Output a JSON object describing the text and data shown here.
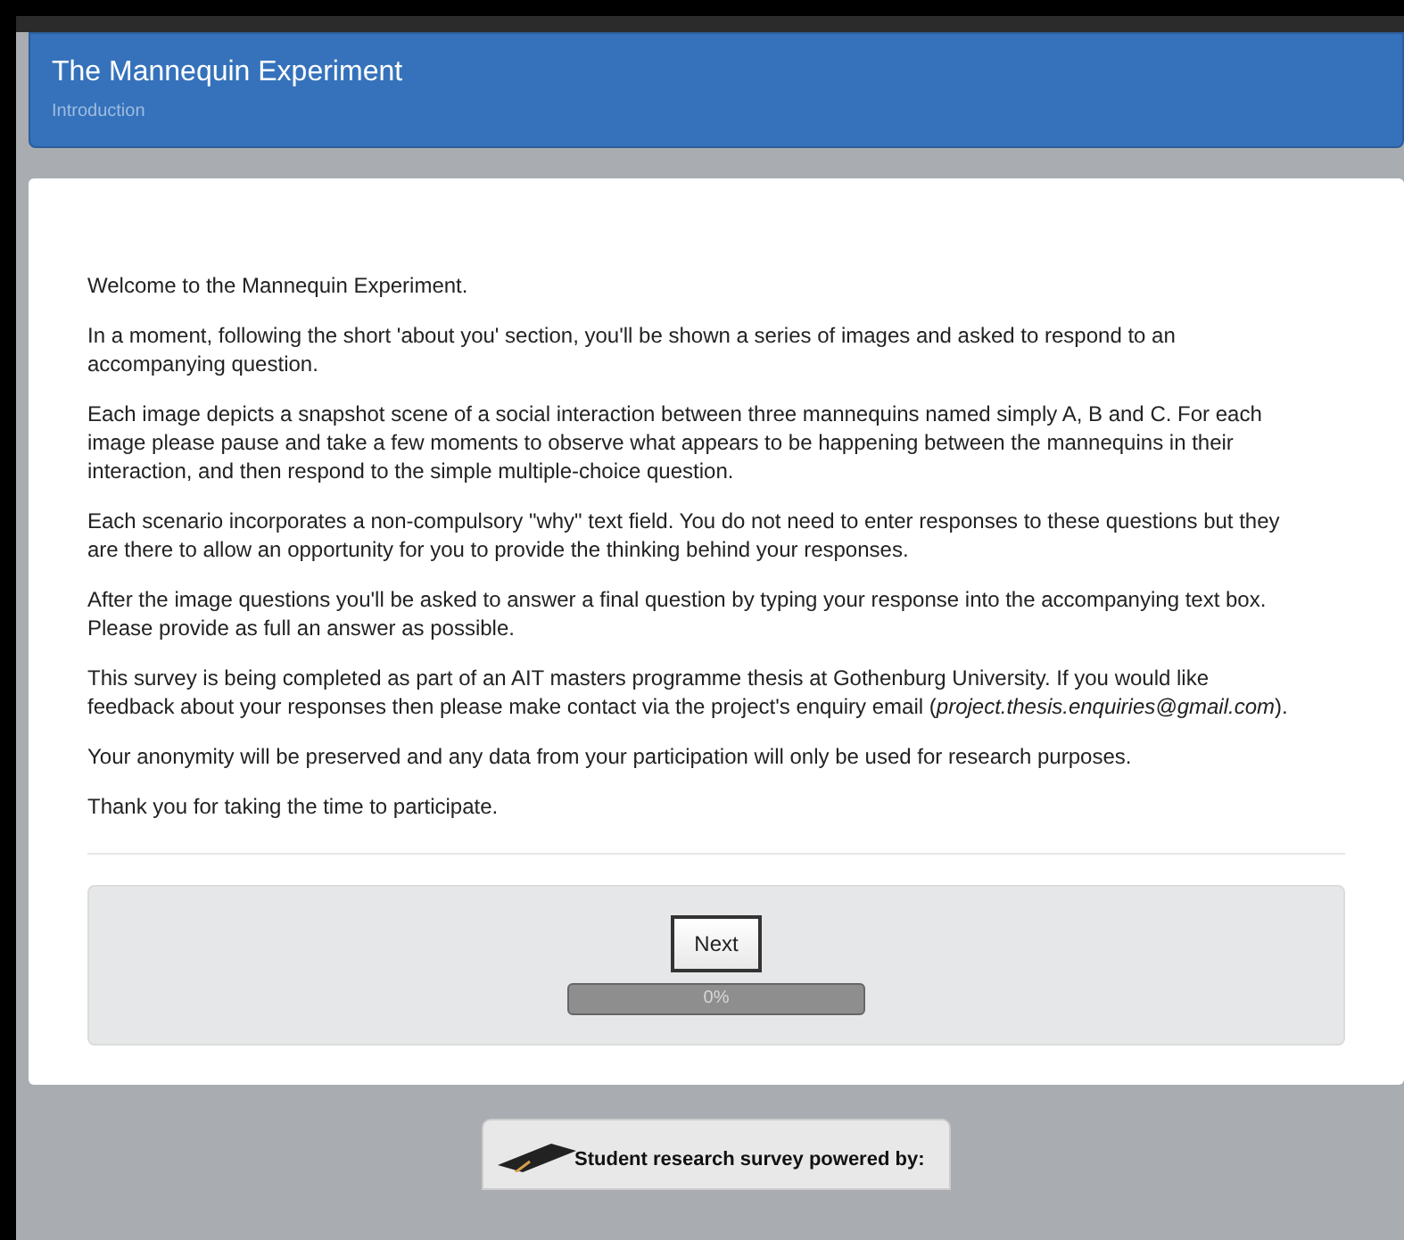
{
  "header": {
    "title": "The Mannequin Experiment",
    "subtitle": "Introduction"
  },
  "paragraphs": [
    "Welcome to the Mannequin Experiment.",
    "In a moment, following the short 'about you' section, you'll be shown a series of images and asked to respond to an accompanying question.",
    "Each image depicts a snapshot scene of a social interaction between three mannequins named simply A, B and C. For each image please pause and take a few moments to observe what appears to be happening between the mannequins in their interaction, and then respond to the simple multiple-choice question.",
    "Each scenario incorporates a non-compulsory \"why\" text field.  You do not need to enter responses to these questions but they are there to allow an opportunity for you to provide the thinking behind your responses.",
    "After the image questions you'll be asked to answer a final question by typing your response into the accompanying text box. Please provide as full an answer as possible.",
    "This survey is being completed as part of an AIT masters programme thesis at Gothenburg University. If you would like feedback about your responses then please make contact via the project's enquiry email (*project.thesis.enquiries@gmail.com*).",
    "Your anonymity will be preserved and any data from your participation will only be used for research purposes.",
    "Thank you for taking the time to participate."
  ],
  "navigation": {
    "button": "Next",
    "progress": {
      "level": 0,
      "reading": "0%"
    }
  },
  "footer": {
    "badge": "Student research survey powered by:"
  }
}
